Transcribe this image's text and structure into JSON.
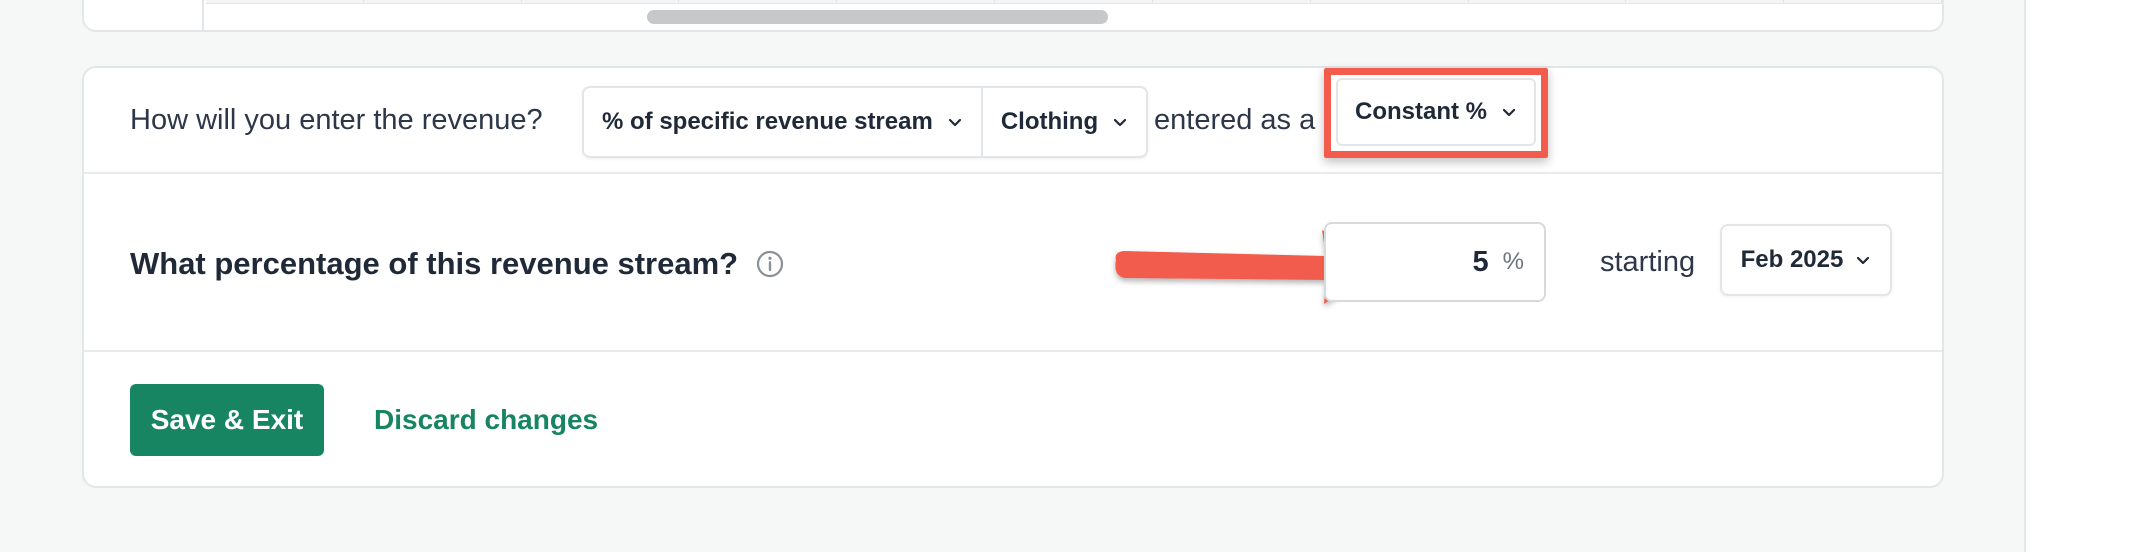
{
  "revenue_entry": {
    "question": "How will you enter the revenue?",
    "method_dropdown": "% of specific revenue stream",
    "stream_dropdown": "Clothing",
    "entered_as_label": "entered as a",
    "entry_type_dropdown": "Constant %"
  },
  "percentage": {
    "question": "What percentage of this revenue stream?",
    "value": "5",
    "unit": "%",
    "starting_label": "starting",
    "start_date_dropdown": "Feb 2025"
  },
  "actions": {
    "save_label": "Save & Exit",
    "discard_label": "Discard changes"
  },
  "colors": {
    "primary_green": "#178561",
    "annotation_red": "#f25c4d"
  },
  "icons": {
    "chevron": "chevron-down-icon",
    "info": "info-icon",
    "annotation": "red-arrow-annotation"
  }
}
